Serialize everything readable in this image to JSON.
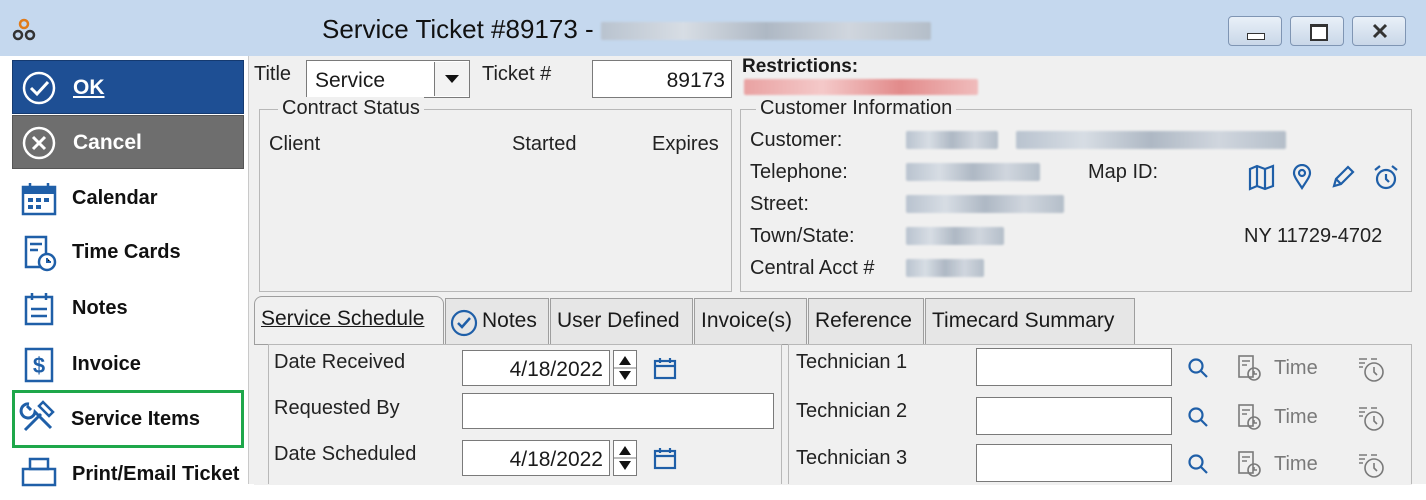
{
  "window": {
    "title": "Service Ticket #89173 -",
    "buttons": [
      "minimize",
      "maximize",
      "close"
    ]
  },
  "sidebar": {
    "ok_label": "OK",
    "cancel_label": "Cancel",
    "items": [
      {
        "label": "Calendar",
        "icon": "calendar-icon"
      },
      {
        "label": "Time Cards",
        "icon": "timecard-icon"
      },
      {
        "label": "Notes",
        "icon": "notes-icon"
      },
      {
        "label": "Invoice",
        "icon": "invoice-dollar-icon"
      },
      {
        "label": "Service Items",
        "icon": "tools-icon",
        "highlighted": true
      },
      {
        "label": "Print/Email Ticket",
        "icon": "printer-icon"
      }
    ]
  },
  "header": {
    "title_label": "Title",
    "title_value": "Service",
    "ticket_label": "Ticket #",
    "ticket_value": "89173",
    "restrictions_label": "Restrictions:"
  },
  "contract_status": {
    "legend": "Contract Status",
    "col_client": "Client",
    "col_started": "Started",
    "col_expires": "Expires"
  },
  "customer_info": {
    "legend": "Customer Information",
    "customer_label": "Customer:",
    "telephone_label": "Telephone:",
    "map_id_label": "Map ID:",
    "street_label": "Street:",
    "town_state_label": "Town/State:",
    "state_zip": "NY  11729-4702",
    "central_acct_label": "Central Acct #"
  },
  "tabs": [
    {
      "label": "Service Schedule",
      "active": true
    },
    {
      "label": "Notes",
      "icon": "check-circle-icon"
    },
    {
      "label": "User Defined"
    },
    {
      "label": "Invoice(s)"
    },
    {
      "label": "Reference"
    },
    {
      "label": "Timecard Summary"
    }
  ],
  "schedule": {
    "date_received_label": "Date Received",
    "date_received": "4/18/2022",
    "requested_by_label": "Requested By",
    "requested_by": "",
    "date_scheduled_label": "Date Scheduled",
    "date_scheduled": "4/18/2022"
  },
  "technicians": [
    {
      "label": "Technician 1",
      "value": "",
      "time_label": "Time"
    },
    {
      "label": "Technician 2",
      "value": "",
      "time_label": "Time"
    },
    {
      "label": "Technician 3",
      "value": "",
      "time_label": "Time"
    }
  ],
  "colors": {
    "ok_bg": "#1e4f94",
    "cancel_bg": "#6e6e6e",
    "highlight_border": "#1ea74a",
    "icon_blue": "#1f5fa8",
    "restrictions_blur": "#e28b8b"
  }
}
